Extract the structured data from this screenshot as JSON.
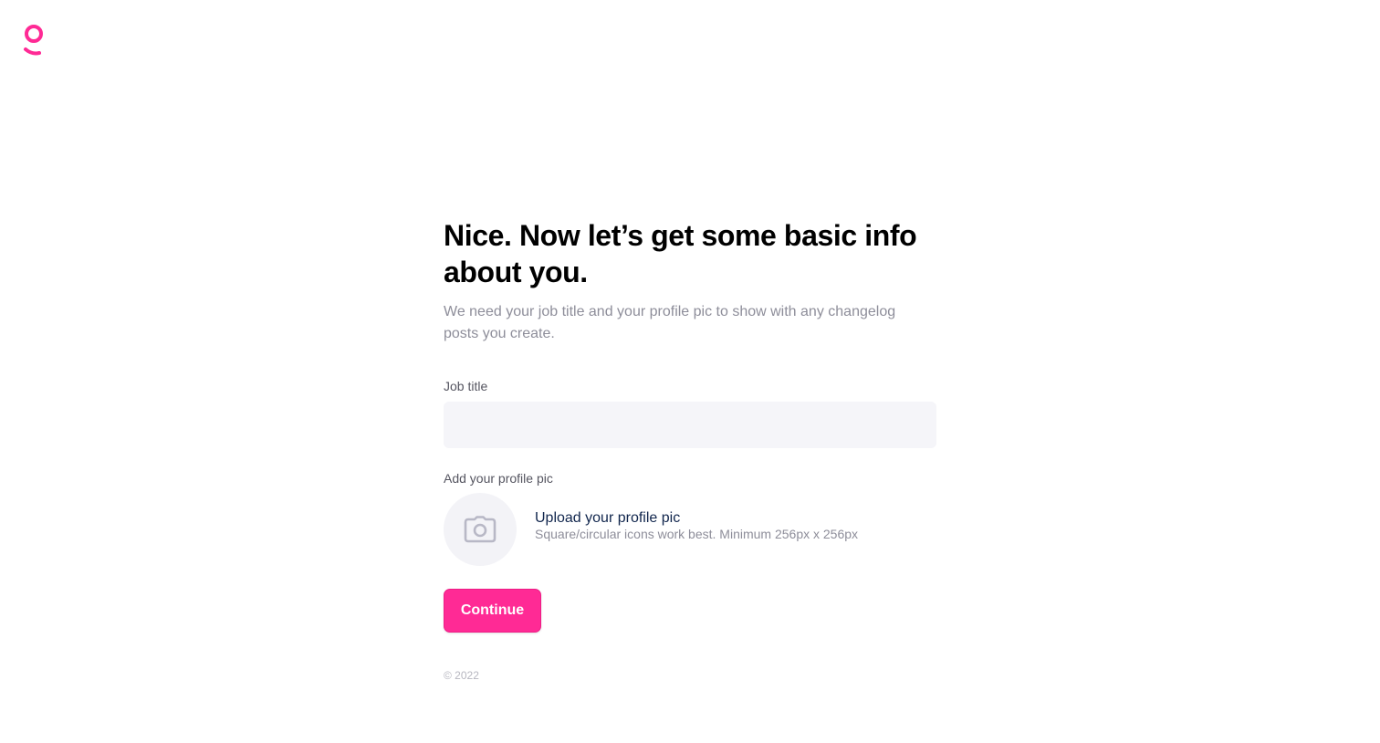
{
  "brand": {
    "logo_icon": "brand-logo-icon",
    "accent_color": "#FF2A95"
  },
  "onboarding": {
    "title": "Nice. Now let’s get some basic info about you.",
    "subtitle": "We need your job title and your profile pic to show with any changelog posts you create.",
    "job_title": {
      "label": "Job title",
      "value": "",
      "placeholder": ""
    },
    "profile_pic": {
      "label": "Add your profile pic",
      "icon": "camera-icon",
      "upload_link": "Upload your profile pic",
      "hint": "Square/circular icons work best. Minimum 256px x 256px"
    },
    "continue_label": "Continue"
  },
  "footer": {
    "copyright": "© 2022"
  }
}
